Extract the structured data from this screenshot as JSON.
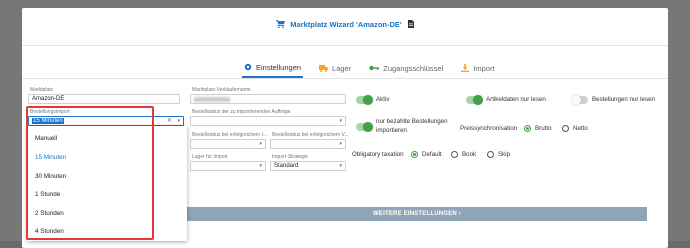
{
  "modal": {
    "title": "Marktplatz Wizard 'Amazon-DE'",
    "icons": {
      "title_left": "cart-icon",
      "title_right": "document-icon"
    }
  },
  "tabs": [
    {
      "label": "Einstellungen",
      "icon": "gear-icon",
      "active": true
    },
    {
      "label": "Lager",
      "icon": "truck-icon"
    },
    {
      "label": "Zugangsschlüssel",
      "icon": "key-icon"
    },
    {
      "label": "Import",
      "icon": "download-icon"
    }
  ],
  "form": {
    "marktplatz_label": "Marktplatz",
    "marktplatz_value": "Amazon-DE",
    "verkaeufer_label": "Marktplatz-Verkäufername",
    "bestellungsimport_label": "Bestellungsimport",
    "bestellungsimport_value": "15 Minuten",
    "bestellstatus_import_label": "Bestellstatus der zu importierenden Aufträge",
    "bestellstatus_erfolg1_label": "Bestellstatus bei erfolgreichem I...",
    "bestellstatus_erfolg2_label": "Bestellstatus bei erfolgreichem V...",
    "lager_import_label": "Lager für Import",
    "import_strategie_label": "Import-Strategie",
    "import_strategie_value": "Standard"
  },
  "toggles": {
    "aktiv": "Aktiv",
    "artikeldaten": "Artikeldaten nur lesen",
    "bestellungen_lesen": "Bestellungen nur lesen",
    "bezahlte_line1": "nur bezahlte Bestellungen",
    "bezahlte_line2": "importieren"
  },
  "preissync": {
    "label": "Preissynchronisation",
    "options": [
      "Brutto",
      "Netto"
    ],
    "selected": "Brutto"
  },
  "taxation": {
    "label": "Obligatory taxation",
    "options": [
      "Default",
      "Book",
      "Skip"
    ],
    "selected": "Default"
  },
  "dropdown_options": [
    "Manuell",
    "15 Minuten",
    "30 Minuten",
    "1 Stunde",
    "2 Stunden",
    "4 Stunden"
  ],
  "dropdown_selected": "15 Minuten",
  "more_button": "WEITERE EINSTELLUNGEN ›",
  "colors": {
    "accent": "#1a73c7",
    "toggle_on": "#43a047",
    "highlight": "#e53935"
  }
}
